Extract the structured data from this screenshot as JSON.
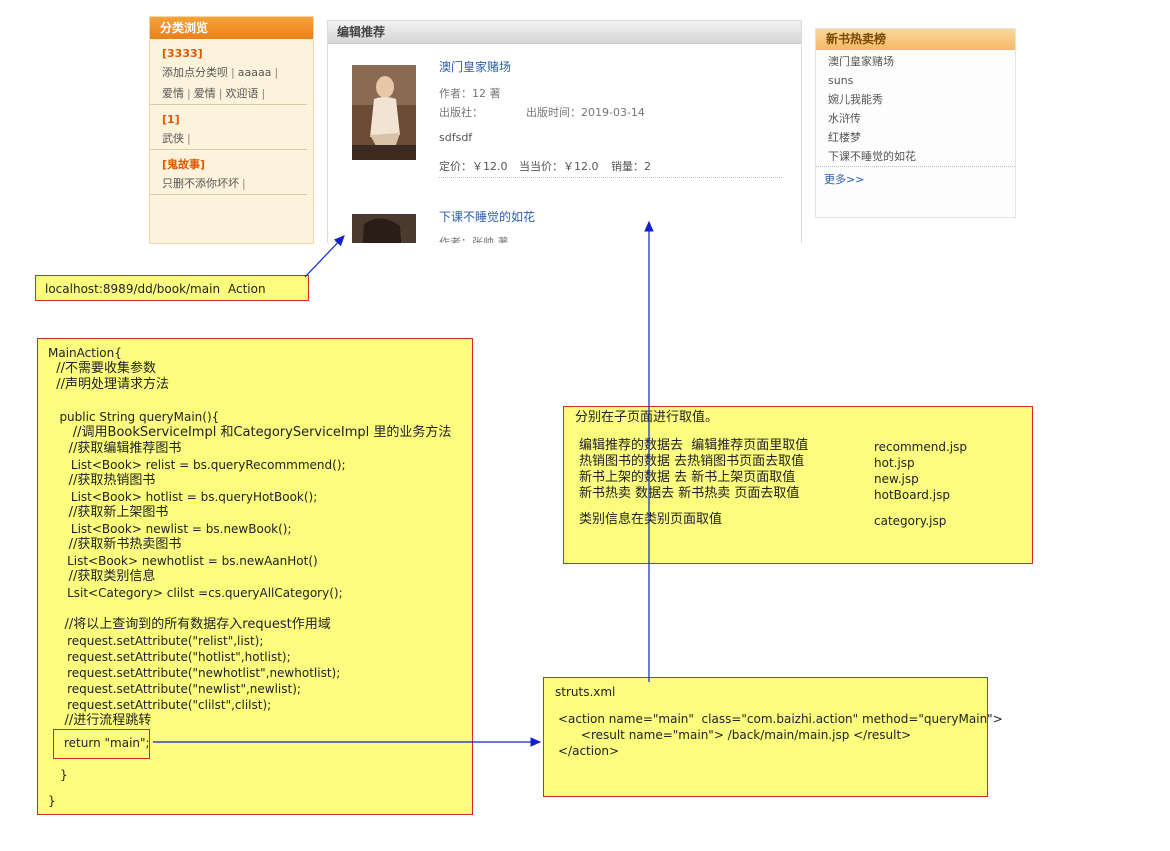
{
  "category": {
    "title": "分类浏览",
    "groups": [
      {
        "name": "[3333]",
        "lines": [
          [
            "添加点分类呗",
            "aaaaa"
          ],
          [
            "爱情",
            "爱情",
            "欢迎语"
          ]
        ]
      },
      {
        "name": "[1]",
        "lines": [
          [
            "武侠"
          ]
        ]
      },
      {
        "name": "[鬼故事]",
        "lines": [
          [
            "只删不添你坏坏"
          ]
        ]
      }
    ]
  },
  "recommend": {
    "title": "编辑推荐",
    "books": [
      {
        "title": "澳门皇家赌场",
        "author": "作者：12 著",
        "publisher": "出版社：",
        "pubdate": "出版时间：2019-03-14",
        "desc": "sdfsdf",
        "price": "定价：￥12.0",
        "dangprice": "当当价：￥12.0",
        "sales": "销量：2"
      },
      {
        "title": "下课不睡觉的如花",
        "author": "作者：张帅 著"
      }
    ]
  },
  "hot": {
    "title": "新书热卖榜",
    "items": [
      "澳门皇家赌场",
      "suns",
      "婉儿我能秀",
      "水浒传",
      "红楼梦",
      "下课不睡觉的如花"
    ],
    "more": "更多>>"
  },
  "url_note": {
    "url": "localhost:8989/dd/book/main",
    "action": "Action"
  },
  "main_action": {
    "lines": [
      "MainAction{",
      "  //不需要收集参数",
      "  //声明处理请求方法",
      "",
      "   public String queryMain(){",
      "      //调用BookServiceImpl 和CategoryServiceImpl 里的业务方法",
      "     //获取编辑推荐图书",
      "      List<Book> relist = bs.queryRecommmend();",
      "     //获取热销图书",
      "      List<Book> hotlist = bs.queryHotBook();",
      "     //获取新上架图书",
      "      List<Book> newlist = bs.newBook();",
      "     //获取新书热卖图书",
      "     List<Book> newhotlist = bs.newAanHot()",
      "     //获取类别信息",
      "     Lsit<Category> clilst =cs.queryAllCategory();",
      "",
      "    //将以上查询到的所有数据存入request作用域",
      "     request.setAttribute(\"relist\",list);",
      "     request.setAttribute(\"hotlist\",hotlist);",
      "     request.setAttribute(\"newhotlist\",newhotlist);",
      "     request.setAttribute(\"newlist\",newlist);",
      "     request.setAttribute(\"clilst\",clilst);",
      "    //进行流程跳转"
    ],
    "return_line": "return \"main\";",
    "close1": "}",
    "close2": "}"
  },
  "subpage_note": {
    "title": "分别在子页面进行取值。",
    "rows": [
      {
        "text": "编辑推荐的数据去  编辑推荐页面里取值",
        "file": "recommend.jsp"
      },
      {
        "text": "热销图书的数据 去热销图书页面去取值",
        "file": "hot.jsp"
      },
      {
        "text": "新书上架的数据 去 新书上架页面取值",
        "file": "new.jsp"
      },
      {
        "text": "新书热卖 数据去 新书热卖 页面去取值",
        "file": "hotBoard.jsp"
      },
      {
        "text": "类别信息在类别页面取值",
        "file": "category.jsp"
      }
    ]
  },
  "struts_note": {
    "title": "struts.xml",
    "lines": [
      "<action name=\"main\"  class=\"com.baizhi.action\" method=\"queryMain\">",
      "      <result name=\"main\"> /back/main/main.jsp </result>",
      "</action>"
    ]
  },
  "colors": {
    "arrow": "#1020d0",
    "note_bg": "#fcfd7f",
    "note_border": "#d22a2a",
    "accent": "#e9801a"
  }
}
